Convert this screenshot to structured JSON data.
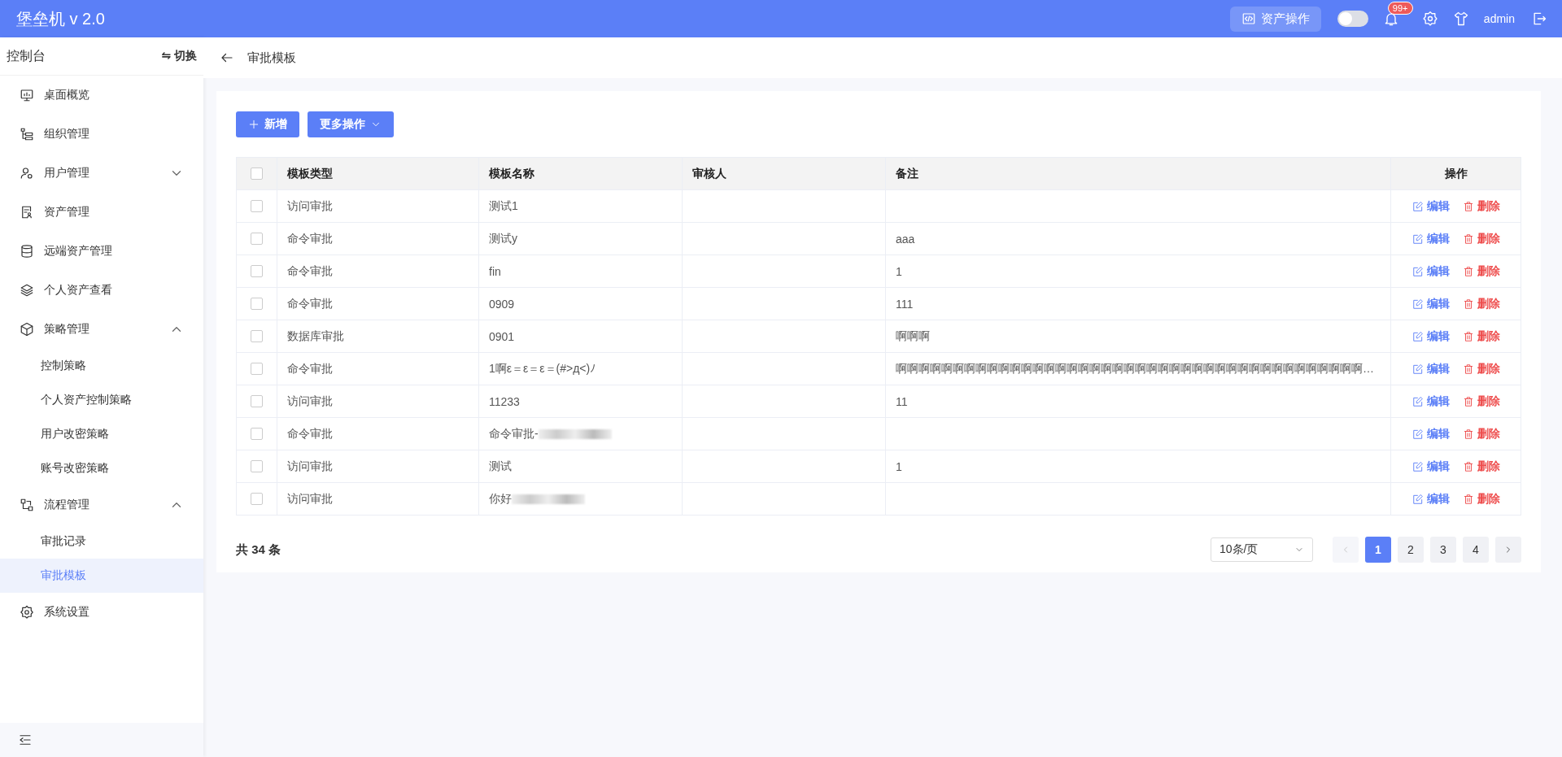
{
  "topbar": {
    "title": "堡垒机 v 2.0",
    "asset_button": "资产操作",
    "theme_switch": {
      "on": false
    },
    "badge": "99+",
    "user": "admin"
  },
  "sidebar": {
    "title": "控制台",
    "switch_label": "⇋ 切换",
    "items": [
      {
        "label": "桌面概览",
        "selected": false
      },
      {
        "label": "组织管理",
        "selected": false
      },
      {
        "label": "用户管理",
        "selected": false,
        "expanded": false
      },
      {
        "label": "资产管理",
        "selected": false
      },
      {
        "label": "远端资产管理",
        "selected": false
      },
      {
        "label": "个人资产查看",
        "selected": false
      },
      {
        "label": "策略管理",
        "selected": false,
        "expanded": true,
        "children": [
          {
            "label": "控制策略",
            "selected": false
          },
          {
            "label": "个人资产控制策略",
            "selected": false
          },
          {
            "label": "用户改密策略",
            "selected": false
          },
          {
            "label": "账号改密策略",
            "selected": false
          }
        ]
      },
      {
        "label": "流程管理",
        "selected": false,
        "expanded": true,
        "children": [
          {
            "label": "审批记录",
            "selected": false
          },
          {
            "label": "审批模板",
            "selected": true
          }
        ]
      },
      {
        "label": "系统设置",
        "selected": false
      }
    ]
  },
  "breadcrumb": "审批模板",
  "toolbar": {
    "add_button": "新增",
    "more_button": "更多操作"
  },
  "table": {
    "columns": [
      "模板类型",
      "模板名称",
      "审核人",
      "备注",
      "操作"
    ],
    "header_checked": false,
    "rows": [
      {
        "checked": false,
        "type": "访问审批",
        "name": "测试1",
        "reviewer": "",
        "remark": "",
        "edit": "编辑",
        "delete": "删除"
      },
      {
        "checked": false,
        "type": "命令审批",
        "name": "测试y",
        "reviewer": "",
        "remark": "aaa",
        "edit": "编辑",
        "delete": "删除"
      },
      {
        "checked": false,
        "type": "命令审批",
        "name": "fin",
        "reviewer": "",
        "remark": "1",
        "edit": "编辑",
        "delete": "删除"
      },
      {
        "checked": false,
        "type": "命令审批",
        "name": "0909",
        "reviewer": "",
        "remark": "111",
        "edit": "编辑",
        "delete": "删除"
      },
      {
        "checked": false,
        "type": "数据库审批",
        "name": "0901",
        "reviewer": "",
        "remark": "啊啊啊",
        "edit": "编辑",
        "delete": "删除"
      },
      {
        "checked": false,
        "type": "命令审批",
        "name": "1啊ε＝ε＝ε＝(#>д<)ﾉ",
        "reviewer": "",
        "remark": "啊啊啊啊啊啊啊啊啊啊啊啊啊啊啊啊啊啊啊啊啊啊啊啊啊啊啊啊啊啊啊啊啊啊啊啊啊啊啊啊啊…",
        "edit": "编辑",
        "delete": "删除"
      },
      {
        "checked": false,
        "type": "访问审批",
        "name": "11233",
        "reviewer": "",
        "remark": "11",
        "edit": "编辑",
        "delete": "删除"
      },
      {
        "checked": false,
        "type": "命令审批",
        "name": "命令审批-",
        "blurred": true,
        "reviewer": "",
        "remark": "",
        "edit": "编辑",
        "delete": "删除"
      },
      {
        "checked": false,
        "type": "访问审批",
        "name": "测试",
        "reviewer": "",
        "remark": "1",
        "edit": "编辑",
        "delete": "删除"
      },
      {
        "checked": false,
        "type": "访问审批",
        "name": "你好",
        "blurred": true,
        "reviewer": "",
        "remark": "",
        "edit": "编辑",
        "delete": "删除"
      }
    ]
  },
  "footer": {
    "total": "共 34 条",
    "page_size": "10条/页",
    "prev_disabled": true,
    "pages": [
      {
        "label": "1",
        "selected": true
      },
      {
        "label": "2",
        "selected": false
      },
      {
        "label": "3",
        "selected": false
      },
      {
        "label": "4",
        "selected": false
      }
    ]
  }
}
